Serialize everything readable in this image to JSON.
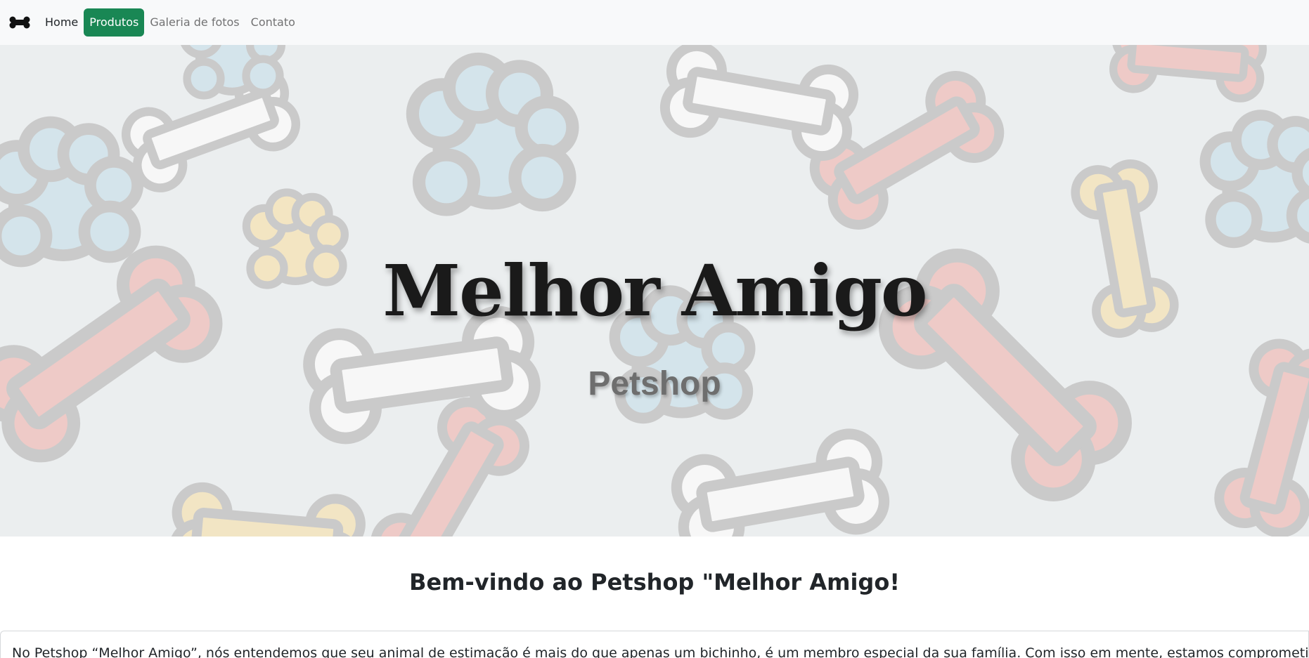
{
  "navbar": {
    "brand_icon": "bone-icon",
    "links": [
      {
        "label": "Home",
        "active": false
      },
      {
        "label": "Produtos",
        "active": true
      },
      {
        "label": "Galeria de fotos",
        "active": false
      },
      {
        "label": "Contato",
        "active": false
      }
    ],
    "active_color": "#198754"
  },
  "hero": {
    "title": "Melhor Amigo",
    "subtitle": "Petshop",
    "background_pattern": "cartoon-bones-and-paws"
  },
  "welcome": {
    "heading": "Bem-vindo ao Petshop \"Melhor Amigo!",
    "intro": "No Petshop “Melhor Amigo”, nós entendemos que seu animal de estimação é mais do que apenas um bichinho, é um membro especial da sua família. Com isso em mente, estamos comprometidos em"
  }
}
